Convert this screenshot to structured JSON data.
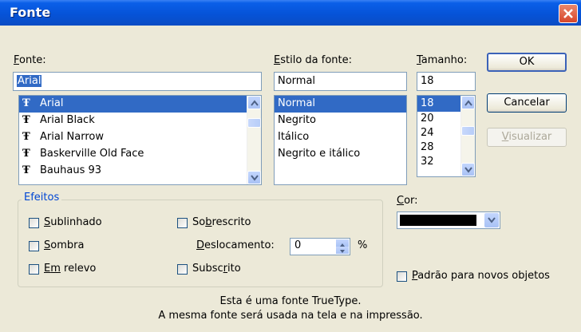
{
  "window": {
    "title": "Fonte"
  },
  "font": {
    "label_prefix": "",
    "label_mnemonic": "F",
    "label_rest": "onte:",
    "value": "Arial",
    "items": [
      "Arial",
      "Arial Black",
      "Arial Narrow",
      "Baskerville Old Face",
      "Bauhaus 93"
    ],
    "selected_index": 0
  },
  "style": {
    "label_mnemonic": "E",
    "label_rest": "stilo da fonte:",
    "value": "Normal",
    "items": [
      "Normal",
      "Negrito",
      "Itálico",
      "Negrito e itálico"
    ],
    "selected_index": 0
  },
  "size": {
    "label_mnemonic": "T",
    "label_rest": "amanho:",
    "value": "18",
    "items": [
      "18",
      "20",
      "24",
      "28",
      "32"
    ],
    "selected_index": 0
  },
  "buttons": {
    "ok": "OK",
    "cancel": "Cancelar",
    "preview_mnemonic": "V",
    "preview_rest": "isualizar"
  },
  "effects": {
    "legend": "Efeitos",
    "underline_m": "S",
    "underline_r": "ublinhado",
    "shadow_m": "S",
    "shadow_r": "ombra",
    "emboss_a": "E",
    "emboss_m": "m",
    "emboss_r": " relevo",
    "superscript_a": "So",
    "superscript_m": "b",
    "superscript_r": "rescrito",
    "offset_m": "D",
    "offset_r": "eslocamento:",
    "offset_value": "0",
    "offset_unit": "%",
    "subscript_a": "Subsc",
    "subscript_m": "r",
    "subscript_r": "ito"
  },
  "color": {
    "label_m": "C",
    "label_r": "or:",
    "value_hex": "#000000"
  },
  "default_checkbox": {
    "label_m": "P",
    "label_r": "adrão para novos objetos"
  },
  "info": {
    "line1": "Esta é uma fonte TrueType.",
    "line2": "A mesma fonte será usada na tela e na impressão."
  },
  "icons": {
    "truetype": "truetype-font-icon",
    "scroll_up": "scroll-up-arrow-icon",
    "scroll_down": "scroll-down-arrow-icon",
    "close": "close-x-icon",
    "dropdown": "chevron-down-icon"
  }
}
